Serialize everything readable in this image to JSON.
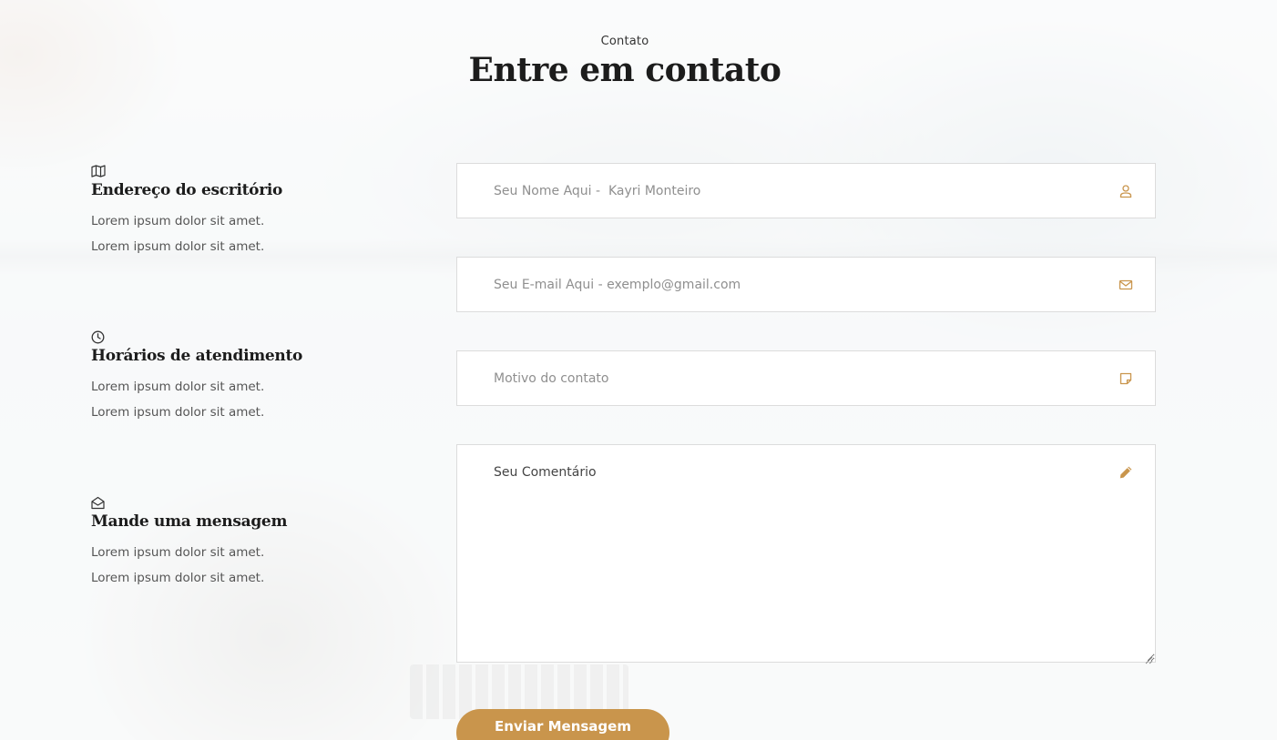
{
  "header": {
    "eyebrow": "Contato",
    "title": "Entre em contato"
  },
  "info": [
    {
      "icon": "map-icon",
      "title": "Endereço do escritório",
      "lines": [
        "Lorem ipsum dolor sit amet.",
        "Lorem ipsum dolor sit amet."
      ]
    },
    {
      "icon": "clock-icon",
      "title": "Horários de atendimento",
      "lines": [
        "Lorem ipsum dolor sit amet.",
        "Lorem ipsum dolor sit amet."
      ]
    },
    {
      "icon": "envelope-open-icon",
      "title": "Mande uma mensagem",
      "lines": [
        "Lorem ipsum dolor sit amet.",
        "Lorem ipsum dolor sit amet."
      ]
    }
  ],
  "form": {
    "name_placeholder": "Seu Nome Aqui -  Kayri Monteiro",
    "name_icon": "user-icon",
    "email_placeholder": "Seu E-mail Aqui - exemplo@gmail.com",
    "email_icon": "mail-icon",
    "subject_placeholder": "Motivo do contato",
    "subject_icon": "note-icon",
    "comment_placeholder": "Seu Comentário",
    "comment_icon": "pencil-icon",
    "submit_label": "Enviar Mensagem"
  },
  "colors": {
    "accent": "#c9954c",
    "heading": "#1c1c1c",
    "body_text": "#555555"
  }
}
